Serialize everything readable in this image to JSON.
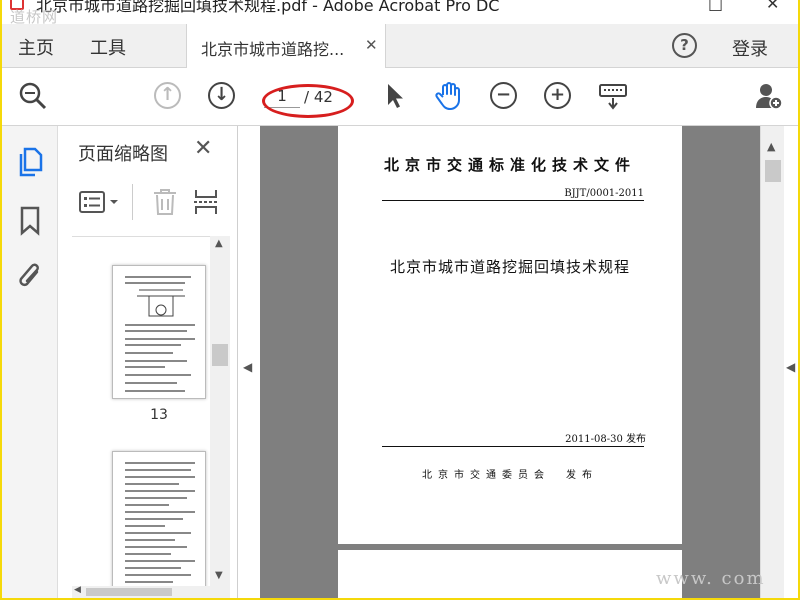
{
  "window": {
    "title": "北京市城市道路挖掘回填技术规程.pdf - Adobe Acrobat Pro DC",
    "watermark_top": "道桥网",
    "watermark_bottom": "www.        com"
  },
  "menubar": {
    "home": "主页",
    "tools": "工具",
    "document_tab": "北京市城市道路挖...",
    "help": "?",
    "login": "登录"
  },
  "toolbar": {
    "current_page": "1",
    "total_pages": "/ 42",
    "icons": [
      "search-icon",
      "page-up-icon",
      "page-down-icon",
      "select-cursor-icon",
      "hand-tool-icon",
      "zoom-out-icon",
      "zoom-in-icon",
      "keyboard-icon",
      "add-user-icon"
    ]
  },
  "thumbnails_panel": {
    "title": "页面缩略图",
    "page_label": "13"
  },
  "document": {
    "doc_type": "北京市交通标准化技术文件",
    "doc_number": "BJJT/0001-2011",
    "title": "北京市城市道路挖掘回填技术规程",
    "publish_date": "2011-08-30 发布",
    "issuer": "北京市交通委员会　发布"
  },
  "colors": {
    "accent_blue": "#1a73e8",
    "annotation_red": "#d71e1e"
  }
}
